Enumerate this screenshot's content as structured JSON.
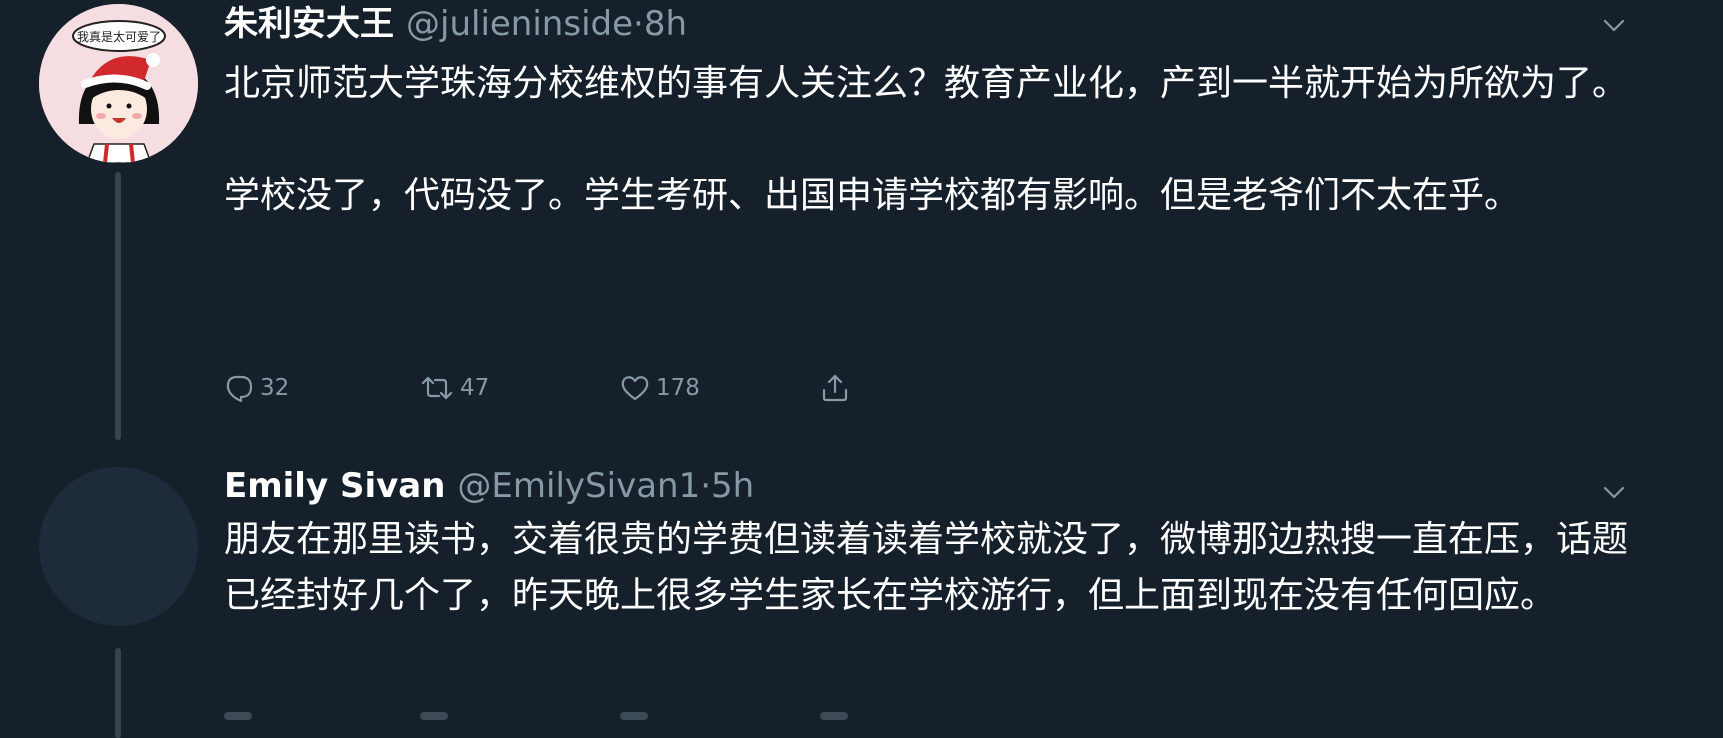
{
  "colors": {
    "background": "#15202b",
    "text_primary": "#ffffff",
    "text_secondary": "#8899a6",
    "thread_line": "#38444d"
  },
  "tweets": [
    {
      "display_name": "朱利安大王",
      "handle": "@julieninside",
      "separator": "·",
      "time": "8h",
      "avatar_text": "我真是太可爱了",
      "paragraphs": [
        "北京师范大学珠海分校维权的事有人关注么？教育产业化，产到一半就开始为所欲为了。",
        "学校没了，代码没了。学生考研、出国申请学校都有影响。但是老爷们不太在乎。"
      ],
      "actions": {
        "replies": "32",
        "retweets": "47",
        "likes": "178"
      },
      "icons": [
        "reply-icon",
        "retweet-icon",
        "like-icon",
        "share-icon",
        "chevron-down-icon"
      ]
    },
    {
      "display_name": "Emily Sivan",
      "handle": "@EmilySivan1",
      "separator": "·",
      "time": "5h",
      "paragraphs": [
        "朋友在那里读书，交着很贵的学费但读着读着学校就没了，微博那边热搜一直在压，话题已经封好几个了，昨天晚上很多学生家长在学校游行，但上面到现在没有任何回应。"
      ],
      "icons": [
        "chevron-down-icon"
      ]
    }
  ]
}
